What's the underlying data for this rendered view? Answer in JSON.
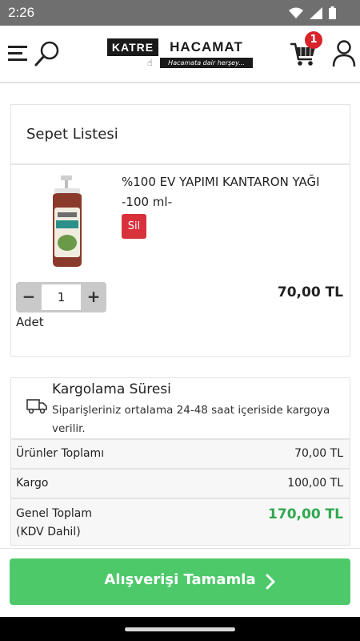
{
  "status_bar": {
    "time": "2:26"
  },
  "header": {
    "logo_left": "KATRE",
    "logo_right": "HACAMAT",
    "logo_tagline": "Hacamata dair herşey...",
    "cart_count": "1",
    "icons": [
      "menu-icon",
      "search-icon",
      "cart-icon",
      "user-icon"
    ]
  },
  "cart": {
    "title": "Sepet Listesi",
    "items": [
      {
        "name": "%100 EV YAPIMI KANTARON YAĞI -100 ml-",
        "delete_label": "Sil",
        "quantity": "1",
        "unit_label": "Adet",
        "price": "70,00 TL"
      }
    ]
  },
  "shipping": {
    "title": "Kargolama Süresi",
    "description": "Siparişleriniz ortalama 24-48 saat içeriside kargoya verilir."
  },
  "summary": {
    "products_total_label": "Ürünler Toplamı",
    "products_total_value": "70,00 TL",
    "shipping_label": "Kargo",
    "shipping_value": "100,00 TL",
    "grand_total_label_line1": "Genel Toplam",
    "grand_total_label_line2": "(KDV Dahil)",
    "grand_total_value": "170,00 TL"
  },
  "checkout": {
    "label": "Alışverişi Tamamla"
  },
  "colors": {
    "status_bar": "#6f6f6f",
    "badge": "#d8232a",
    "delete": "#d9313c",
    "checkout": "#4dc96a",
    "total": "#2fa84f"
  }
}
